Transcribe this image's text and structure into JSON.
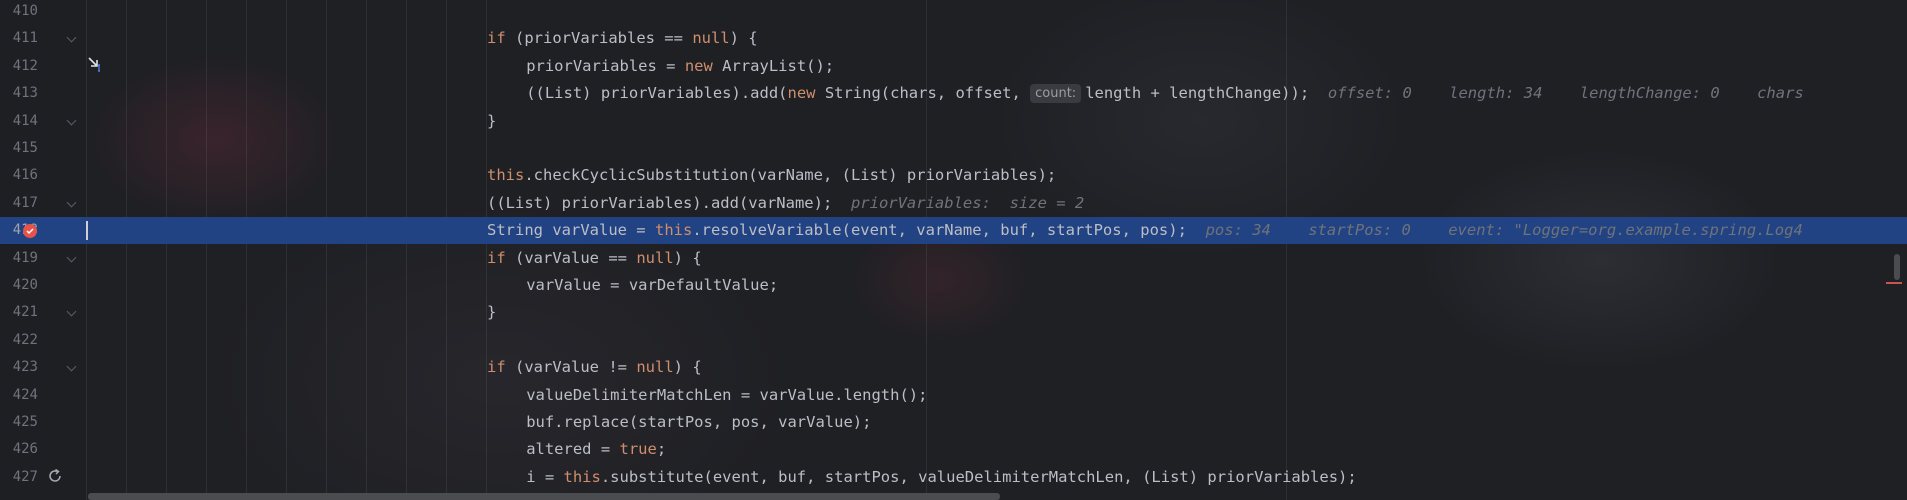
{
  "editor": {
    "lines": [
      {
        "num": "410",
        "indent": "",
        "parts": []
      },
      {
        "num": "411",
        "indent": "            ",
        "parts": [
          {
            "t": "if",
            "c": "kw"
          },
          {
            "t": " (priorVariables == "
          },
          {
            "t": "null",
            "c": "kw"
          },
          {
            "t": ") {"
          }
        ]
      },
      {
        "num": "412",
        "indent": "                ",
        "parts": [
          {
            "t": "priorVariables = "
          },
          {
            "t": "new",
            "c": "kw"
          },
          {
            "t": " ArrayList();"
          }
        ]
      },
      {
        "num": "413",
        "indent": "                ",
        "parts": [
          {
            "t": "((List) priorVariables).add("
          },
          {
            "t": "new",
            "c": "kw"
          },
          {
            "t": " String(chars, offset, "
          },
          {
            "t": "count:",
            "c": "chip"
          },
          {
            "t": "length + lengthChange));"
          },
          {
            "t": "  offset: 0    length: 34    lengthChange: 0    chars",
            "c": "hint"
          }
        ]
      },
      {
        "num": "414",
        "indent": "            ",
        "parts": [
          {
            "t": "}"
          }
        ]
      },
      {
        "num": "415",
        "indent": "",
        "parts": []
      },
      {
        "num": "416",
        "indent": "            ",
        "parts": [
          {
            "t": "this",
            "c": "kw"
          },
          {
            "t": ".checkCyclicSubstitution(varName, (List) priorVariables);"
          }
        ]
      },
      {
        "num": "417",
        "indent": "            ",
        "parts": [
          {
            "t": "((List) priorVariables).add(varName);"
          },
          {
            "t": "  priorVariables:  size = 2",
            "c": "hint"
          }
        ]
      },
      {
        "num": "418",
        "indent": "            ",
        "parts": [
          {
            "t": "String varValue = "
          },
          {
            "t": "this",
            "c": "kw"
          },
          {
            "t": ".resolveVariable(event, varName, buf, startPos, pos);"
          },
          {
            "t": "  pos: 34    startPos: 0    event: \"Logger=org.example.spring.Log4",
            "c": "hint"
          }
        ]
      },
      {
        "num": "419",
        "indent": "            ",
        "parts": [
          {
            "t": "if",
            "c": "kw"
          },
          {
            "t": " (varValue == "
          },
          {
            "t": "null",
            "c": "kw"
          },
          {
            "t": ") {"
          }
        ]
      },
      {
        "num": "420",
        "indent": "                ",
        "parts": [
          {
            "t": "varValue = varDefaultValue;"
          }
        ]
      },
      {
        "num": "421",
        "indent": "            ",
        "parts": [
          {
            "t": "}"
          }
        ]
      },
      {
        "num": "422",
        "indent": "",
        "parts": []
      },
      {
        "num": "423",
        "indent": "            ",
        "parts": [
          {
            "t": "if",
            "c": "kw"
          },
          {
            "t": " (varValue != "
          },
          {
            "t": "null",
            "c": "kw"
          },
          {
            "t": ") {"
          }
        ]
      },
      {
        "num": "424",
        "indent": "                ",
        "parts": [
          {
            "t": "valueDelimiterMatchLen = varValue.length();"
          }
        ]
      },
      {
        "num": "425",
        "indent": "                ",
        "parts": [
          {
            "t": "buf.replace(startPos, pos, varValue);"
          }
        ]
      },
      {
        "num": "426",
        "indent": "                ",
        "parts": [
          {
            "t": "altered = "
          },
          {
            "t": "true",
            "c": "kw"
          },
          {
            "t": ";"
          }
        ]
      },
      {
        "num": "427",
        "indent": "                ",
        "parts": [
          {
            "t": "i = "
          },
          {
            "t": "this",
            "c": "kw"
          },
          {
            "t": ".substitute(event, buf, startPos, valueDelimiterMatchLen, (List) priorVariables);"
          }
        ]
      }
    ],
    "current_line": "418",
    "breakpoint_line": "418",
    "fold_lines": [
      "411",
      "414",
      "417",
      "419",
      "421",
      "423"
    ],
    "icons": {
      "breakpoint": "breakpoint-icon",
      "step": "step-into-icon",
      "reload": "reload-icon"
    },
    "colors": {
      "keyword": "#cf8e6d",
      "text": "#bcbec4",
      "hint": "#6f737a",
      "current_line": "#214283",
      "breakpoint": "#e5534b"
    }
  }
}
